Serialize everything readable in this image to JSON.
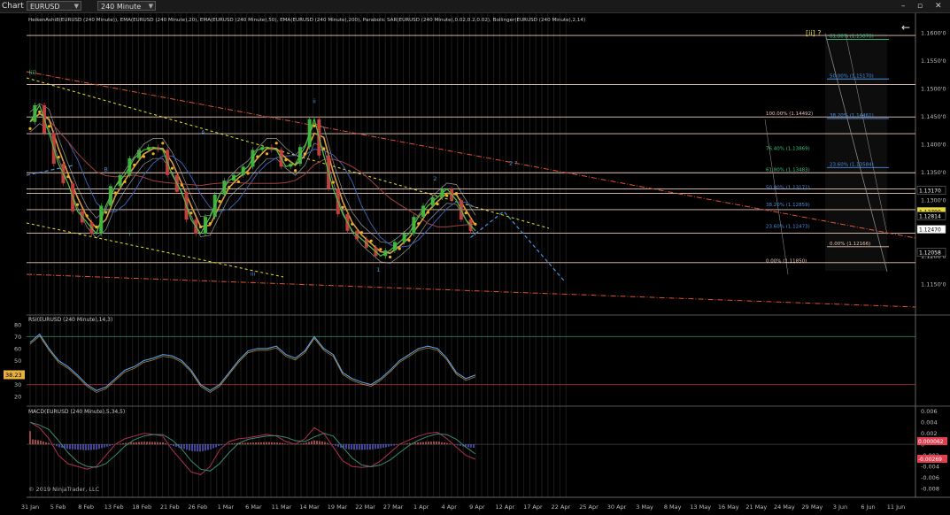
{
  "toolbar": {
    "chart_tab": "Chart",
    "instrument": "EURUSD",
    "interval": "240 Minute",
    "buttons": [
      "–",
      "▫",
      "✕"
    ]
  },
  "price_panel": {
    "indicator_title": "HeikenAshi8(EURUSD (240 Minute)), EMA(EURUSD (240 Minute),20), EMA(EURUSD (240 Minute),50), EMA(EURUSD (240 Minute),200), Parabolic SAR(EURUSD (240 Minute),0.02,0.2,0.02), Bollinger(EURUSD (240 Minute),2,14)",
    "wave_label_top": "[ii] ?",
    "back_arrow": "←",
    "copyright": "© 2019 NinjaTrader, LLC"
  },
  "colors": {
    "background": "#000000",
    "hline": "#e8c8b8",
    "channel_upper": "#e05030",
    "channel_yellow": "#e8e820",
    "sar": "#f0b020",
    "projection": "#4a90e0",
    "fib_green": "#40c080",
    "fib_blue": "#4a90e0",
    "rsi": "#5aa0e0",
    "macd_pos": "#ff7070",
    "macd_neg": "#7070ff"
  },
  "chart_data": {
    "type": "line",
    "x_ticks": [
      "31 Jan",
      "5 Feb",
      "8 Feb",
      "13 Feb",
      "18 Feb",
      "21 Feb",
      "26 Feb",
      "1 Mar",
      "6 Mar",
      "11 Mar",
      "14 Mar",
      "19 Mar",
      "22 Mar",
      "27 Mar",
      "1 Apr",
      "4 Apr",
      "9 Apr",
      "12 Apr",
      "17 Apr",
      "22 Apr",
      "25 Apr",
      "30 Apr",
      "3 May",
      "8 May",
      "13 May",
      "16 May",
      "21 May",
      "24 May",
      "29 May",
      "3 Jun",
      "6 Jun",
      "11 Jun"
    ],
    "price_axis": {
      "ticks": [
        "1.1600'0",
        "1.1550'0",
        "1.1500'0",
        "1.1450'0",
        "1.1400'0",
        "1.1350'0",
        "1.1300'0",
        "1.1250'0",
        "1.1200'0",
        "1.1150'0"
      ],
      "tick_values": [
        1.16,
        1.155,
        1.15,
        1.145,
        1.14,
        1.135,
        1.13,
        1.125,
        1.12,
        1.115
      ],
      "ylim": [
        1.1118,
        1.1622
      ]
    },
    "price_labels": [
      {
        "text": "1.13170",
        "value": 1.1317,
        "bg": "#000000",
        "fg": "#ffffff"
      },
      {
        "text": "1.12790",
        "value": 1.1279,
        "bg": "#e8d830",
        "fg": "#000000"
      },
      {
        "text": "1.12814",
        "value": 1.1271,
        "bg": "#000000",
        "fg": "#ffffff"
      },
      {
        "text": "1.12470",
        "value": 1.1247,
        "bg": "#ffffff",
        "fg": "#000000"
      },
      {
        "text": "1.12058",
        "value": 1.1206,
        "bg": "#000000",
        "fg": "#ffffff"
      }
    ],
    "horizontal_levels": [
      1.1595,
      1.1507,
      1.1449,
      1.1419,
      1.1349,
      1.1312,
      1.1283,
      1.1241,
      1.1188,
      1.132
    ],
    "fib_retracement_left": [
      {
        "label": "100.00% (1.14492)",
        "value": 1.14492,
        "color": "#e8c8b8"
      },
      {
        "label": "76.40% (1.13869)",
        "value": 1.13869,
        "color": "#40c080"
      },
      {
        "label": "61.80% (1.13483)",
        "value": 1.13483,
        "color": "#40c080"
      },
      {
        "label": "50.00% (1.13171)",
        "value": 1.13171,
        "color": "#4a90e0"
      },
      {
        "label": "38.20% (1.12859)",
        "value": 1.12859,
        "color": "#4a90e0"
      },
      {
        "label": "23.60% (1.12473)",
        "value": 1.12473,
        "color": "#4a90e0"
      },
      {
        "label": "0.00% (1.11850)",
        "value": 1.1185,
        "color": "#e8c8b8"
      }
    ],
    "fib_retracement_right": [
      {
        "label": "61.80% (1.15878)",
        "value": 1.15878,
        "color": "#40c080"
      },
      {
        "label": "50.00% (1.15170)",
        "value": 1.1517,
        "color": "#4a90e0"
      },
      {
        "label": "38.20% (1.14461)",
        "value": 1.14461,
        "color": "#4a90e0"
      },
      {
        "label": "23.60% (1.13584)",
        "value": 1.13584,
        "color": "#4a90e0"
      },
      {
        "label": "0.00% (1.12166)",
        "value": 1.12166,
        "color": "#e8c8b8"
      }
    ],
    "wave_labels": [
      {
        "text": "(ii)",
        "t": 0.5,
        "value": 1.1525,
        "color": "#40c080"
      },
      {
        "text": "A",
        "t": 36.5,
        "value": 1.1418,
        "color": "#4a90e0"
      },
      {
        "text": "B",
        "t": 16,
        "value": 1.1352,
        "color": "#4a90e0"
      },
      {
        "text": "i",
        "t": 21,
        "value": 1.1236,
        "color": "#40c080"
      },
      {
        "text": "ii",
        "t": 60,
        "value": 1.1474,
        "color": "#4a90e0"
      },
      {
        "text": "iii",
        "t": 47,
        "value": 1.1165,
        "color": "#4a90e0"
      },
      {
        "text": "1",
        "t": 73.5,
        "value": 1.1172,
        "color": "#4a90e0"
      },
      {
        "text": "2",
        "t": 85.5,
        "value": 1.1335,
        "color": "#4a90e0"
      },
      {
        "text": "2 ?",
        "t": 102,
        "value": 1.1363,
        "color": "#4a90e0"
      }
    ],
    "price_series": {
      "name": "EURUSD",
      "t": [
        0,
        2,
        4,
        6,
        8,
        10,
        12,
        14,
        16,
        18,
        20,
        22,
        24,
        26,
        28,
        30,
        32,
        34,
        36,
        38,
        40,
        42,
        44,
        46,
        48,
        50,
        52,
        54,
        56,
        58,
        60,
        62,
        64,
        66,
        68,
        70,
        72,
        74,
        76,
        78,
        80,
        82,
        84,
        86,
        88,
        90,
        92,
        94
      ],
      "values": [
        1.144,
        1.147,
        1.142,
        1.1365,
        1.133,
        1.128,
        1.126,
        1.124,
        1.129,
        1.1325,
        1.1345,
        1.1375,
        1.139,
        1.1395,
        1.139,
        1.1345,
        1.1315,
        1.1265,
        1.124,
        1.127,
        1.131,
        1.1335,
        1.1345,
        1.136,
        1.139,
        1.1395,
        1.139,
        1.136,
        1.1365,
        1.1395,
        1.1445,
        1.138,
        1.132,
        1.1275,
        1.1245,
        1.123,
        1.1215,
        1.12,
        1.121,
        1.1225,
        1.124,
        1.127,
        1.129,
        1.1305,
        1.132,
        1.13,
        1.1265,
        1.1245
      ]
    },
    "projection": {
      "t": [
        93,
        100,
        113
      ],
      "values": [
        1.1233,
        1.128,
        1.1153
      ]
    },
    "rsi": {
      "title": "RSI(EURUSD (240 Minute),14,3)",
      "ticks": [
        "80",
        "70",
        "60",
        "50",
        "40",
        "30",
        "20"
      ],
      "tick_values": [
        80,
        70,
        60,
        50,
        40,
        30,
        20
      ],
      "ylim": [
        15,
        85
      ],
      "levels": [
        70,
        30
      ],
      "current": "38.23",
      "values": [
        65,
        72,
        60,
        50,
        45,
        38,
        30,
        25,
        28,
        35,
        42,
        45,
        50,
        52,
        55,
        54,
        50,
        42,
        30,
        25,
        30,
        40,
        50,
        58,
        60,
        60,
        62,
        55,
        52,
        58,
        70,
        60,
        55,
        40,
        35,
        32,
        30,
        35,
        42,
        50,
        55,
        60,
        62,
        60,
        52,
        40,
        35,
        38
      ]
    },
    "macd": {
      "title": "MACD(EURUSD (240 Minute),5,34,5)",
      "ticks": [
        "0.006",
        "0.004",
        "0.002",
        "0",
        "-0.002",
        "-0.004",
        "-0.006",
        "-0.008"
      ],
      "tick_values": [
        0.006,
        0.004,
        0.002,
        0,
        -0.002,
        -0.004,
        -0.006,
        -0.008
      ],
      "ylim": [
        -0.0088,
        0.0066
      ],
      "label_top": "0.000062",
      "label_bottom": "-0.00269",
      "values": [
        0.004,
        0.003,
        0.001,
        -0.002,
        -0.0035,
        -0.004,
        -0.0045,
        -0.004,
        -0.002,
        0.0,
        0.001,
        0.0015,
        0.002,
        0.0018,
        0.0015,
        -0.001,
        -0.003,
        -0.005,
        -0.0055,
        -0.004,
        -0.001,
        0.0005,
        0.001,
        0.0012,
        0.0015,
        0.0018,
        0.0015,
        0.0005,
        0.0,
        0.001,
        0.003,
        0.002,
        -0.0005,
        -0.003,
        -0.004,
        -0.0042,
        -0.004,
        -0.003,
        -0.0015,
        0.0,
        0.0008,
        0.0015,
        0.002,
        0.0022,
        0.001,
        -0.0005,
        -0.002,
        -0.0027
      ]
    }
  }
}
